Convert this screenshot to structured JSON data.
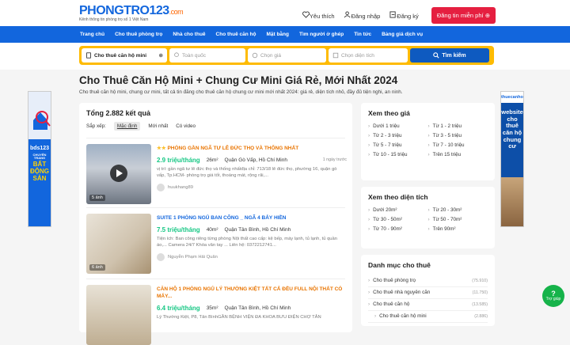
{
  "header": {
    "logo": "PHONGTRO123",
    "logo_domain": ".com",
    "tagline": "Kênh thông tin phòng trọ số 1 Việt Nam",
    "favorite": "Yêu thích",
    "login": "Đăng nhập",
    "register": "Đăng ký",
    "post": "Đăng tin miễn phí"
  },
  "nav": [
    "Trang chủ",
    "Cho thuê phòng trọ",
    "Nhà cho thuê",
    "Cho thuê căn hộ",
    "Mặt bằng",
    "Tìm người ở ghép",
    "Tin tức",
    "Bảng giá dịch vụ"
  ],
  "search": {
    "type": "Cho thuê căn hộ mini",
    "location": "Toàn quốc",
    "price": "Chọn giá",
    "area": "Chọn diện tích",
    "button": "Tìm kiếm"
  },
  "page": {
    "title": "Cho Thuê Căn Hộ Mini + Chung Cư Mini Giá Rẻ, Mới Nhất 2024",
    "desc": "Cho thuê căn hộ mini, chung cư mini, tất cả tin đăng cho thuê căn hộ chung cư mini mới nhất 2024: giá rẻ, diện tích nhỏ, đầy đủ tiện nghi, an ninh."
  },
  "banner_left": {
    "brand": "bds123",
    "slogan": "CHUYÊN TRANG",
    "l1": "BẤT",
    "l2": "ĐỘNG",
    "l3": "SẢN"
  },
  "banner_right": {
    "site": "thuecanho123.com",
    "l1": "website",
    "l2": "cho thuê",
    "l3": "căn hộ",
    "l4": "chung cư"
  },
  "listing": {
    "total": "Tổng 2.882 kết quả",
    "sort_label": "Sắp xếp:",
    "sort": [
      "Mặc định",
      "Mới nhất",
      "Có video"
    ],
    "items": [
      {
        "title": "PHÒNG GẦN NGÃ TƯ LÊ ĐỨC THỌ VÀ THỐNG NHẤT",
        "price": "2.9 triệu/tháng",
        "area": "26m²",
        "location": "Quận Gò Vấp, Hồ Chí Minh",
        "time": "1 ngày trước",
        "desc": "vị trí: gần ngã tư lê đức thọ và thống nhấtđịa chỉ: 713/18 lê đức thọ, phường 16, quận gò vấp, Tp.HCM- phòng trọ giá tốt, thoáng mát, rộng rãi,...",
        "author": "huukhang89",
        "count": "5 ảnh"
      },
      {
        "title": "SUITE 1 PHÒNG NGỦ BAN CÔNG _ NGÃ 4 BẢY HIỀN",
        "price": "7.5 triệu/tháng",
        "area": "40m²",
        "location": "Quận Tân Bình, Hồ Chí Minh",
        "time": "",
        "desc": "Tiện ích: Ban công riêng từng phòng Nội thất cao cấp: kệ bếp, máy lạnh, tủ lạnh, tủ quần áo,... Camera 24/7 Khóa vân tay ... Liên hệ: 0372212741...",
        "author": "Nguyễn Phạm Hải Quân",
        "count": "6 ảnh"
      },
      {
        "title": "CĂN HỘ 1 PHÒNG NGỦ LÝ THƯỜNG KIỆT TẤT CẢ ĐỀU FULL NỘI THẤT CÓ MÁY...",
        "price": "6.4 triệu/tháng",
        "area": "35m²",
        "location": "Quận Tân Bình, Hồ Chí Minh",
        "time": "",
        "desc": "Lý Thường Kiệt, P8, Tân BìnhGẦN BỆNH VIỆN ĐA KHOA BƯU ĐIỆN CHỢ TÂN",
        "author": "",
        "count": ""
      }
    ]
  },
  "price_filter": {
    "title": "Xem theo giá",
    "items": [
      "Dưới 1 triệu",
      "Từ 1 - 2 triệu",
      "Từ 2 - 3 triệu",
      "Từ 3 - 5 triệu",
      "Từ 5 - 7 triệu",
      "Từ 7 - 10 triệu",
      "Từ 10 - 15 triệu",
      "Trên 15 triệu"
    ]
  },
  "area_filter": {
    "title": "Xem theo diện tích",
    "items": [
      "Dưới 20m²",
      "Từ 20 - 30m²",
      "Từ 30 - 50m²",
      "Từ 50 - 70m²",
      "Từ 70 - 90m²",
      "Trên 90m²"
    ]
  },
  "categories": {
    "title": "Danh mục cho thuê",
    "items": [
      {
        "name": "Cho thuê phòng trọ",
        "count": "(75.910)"
      },
      {
        "name": "Cho thuê nhà nguyên căn",
        "count": "(11.750)"
      },
      {
        "name": "Cho thuê căn hộ",
        "count": "(13.585)"
      },
      {
        "name": "Cho thuê căn hộ mini",
        "count": "(2.886)"
      }
    ]
  },
  "help": "Trợ giúp"
}
